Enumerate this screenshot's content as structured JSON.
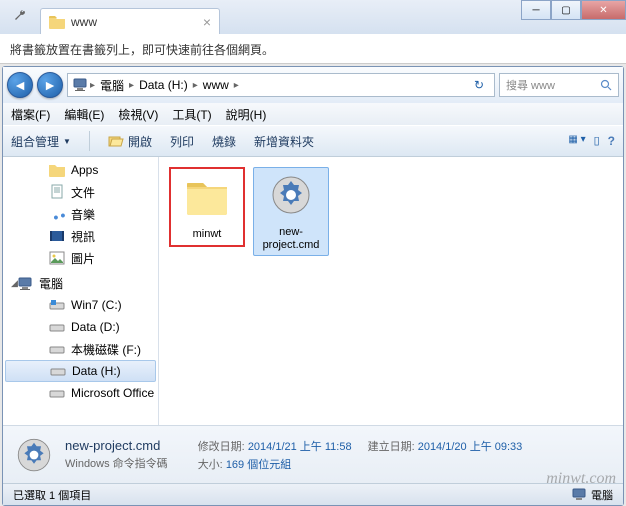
{
  "chrome": {
    "tab_title": "www",
    "bookmark_hint": "將書籤放置在書籤列上，即可快速前往各個網頁。"
  },
  "explorer": {
    "breadcrumb": [
      "電腦",
      "Data (H:)",
      "www"
    ],
    "search_placeholder": "搜尋 www",
    "menubar": {
      "file": "檔案(F)",
      "edit": "編輯(E)",
      "view": "檢視(V)",
      "tools": "工具(T)",
      "help": "說明(H)"
    },
    "toolbar": {
      "organize": "組合管理",
      "open": "開啟",
      "print": "列印",
      "burn": "燒錄",
      "newfolder": "新增資料夾"
    },
    "sidebar": {
      "items": [
        {
          "label": "Apps",
          "icon": "folder"
        },
        {
          "label": "文件",
          "icon": "doc"
        },
        {
          "label": "音樂",
          "icon": "music"
        },
        {
          "label": "視訊",
          "icon": "video"
        },
        {
          "label": "圖片",
          "icon": "picture"
        }
      ],
      "computer_label": "電腦",
      "drives": [
        {
          "label": "Win7 (C:)",
          "icon": "drive-win"
        },
        {
          "label": "Data (D:)",
          "icon": "drive"
        },
        {
          "label": "本機磁碟 (F:)",
          "icon": "drive"
        },
        {
          "label": "Data (H:)",
          "icon": "drive",
          "selected": true
        },
        {
          "label": "Microsoft Office",
          "icon": "drive"
        }
      ]
    },
    "files": [
      {
        "name": "minwt",
        "type": "folder",
        "highlighted": true
      },
      {
        "name": "new-project.cmd",
        "type": "cmd",
        "selected": true
      }
    ],
    "details": {
      "name": "new-project.cmd",
      "type": "Windows 命令指令碼",
      "mod_label": "修改日期:",
      "mod_value": "2014/1/21 上午 11:58",
      "size_label": "大小:",
      "size_value": "169 個位元組",
      "created_label": "建立日期:",
      "created_value": "2014/1/20 上午 09:33"
    },
    "status": {
      "text": "已選取 1 個項目",
      "right": "電腦"
    }
  },
  "watermark": "minwt.com"
}
